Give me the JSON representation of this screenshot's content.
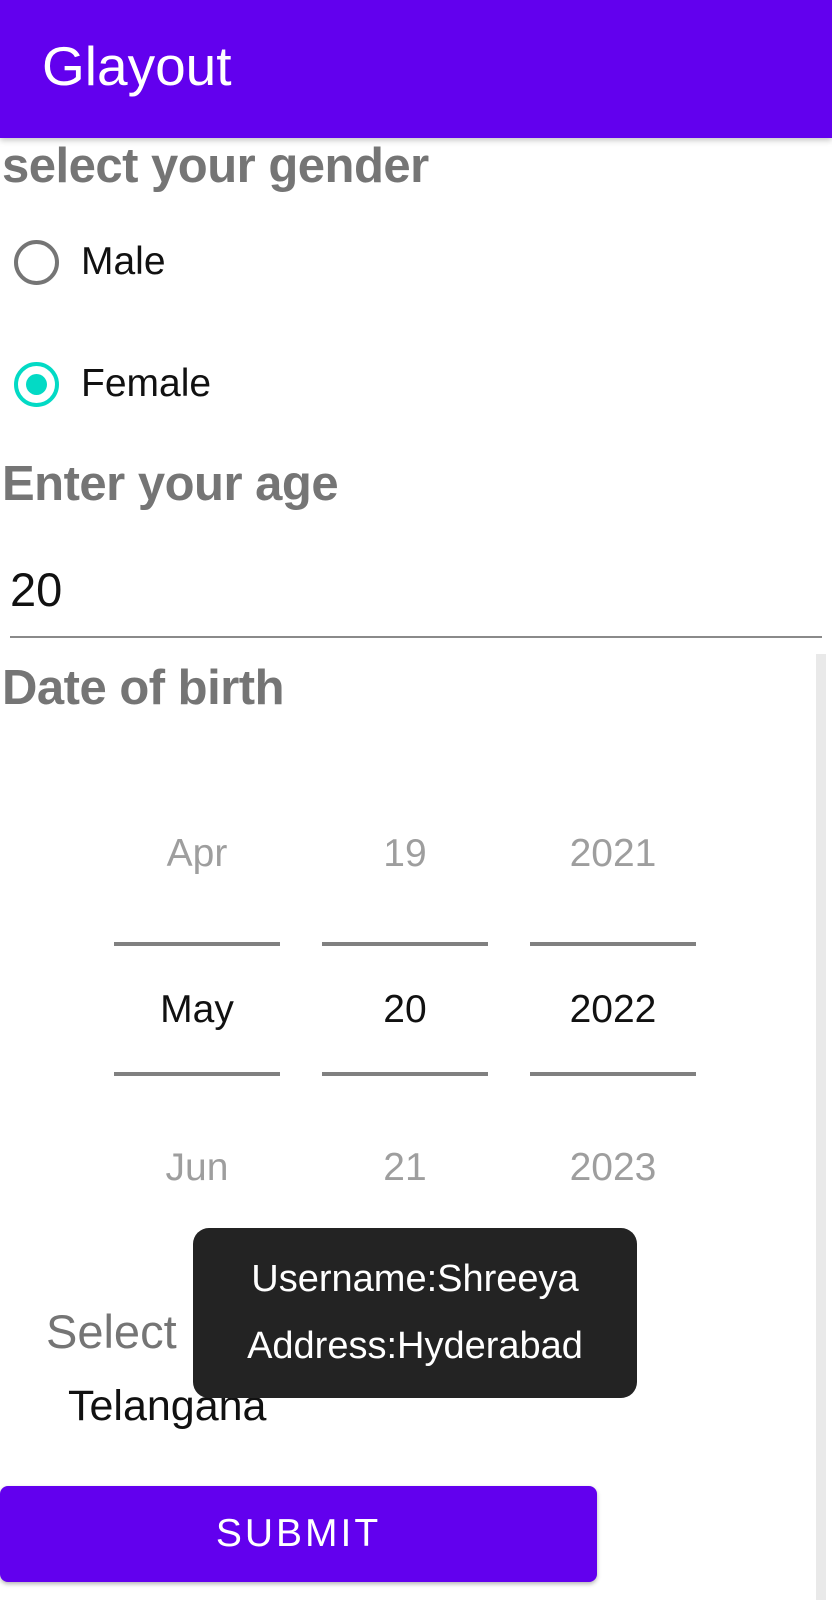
{
  "app_bar": {
    "title": "Glayout",
    "color": "#6200EE"
  },
  "gender": {
    "label": "select your gender",
    "options": [
      {
        "label": "Male",
        "checked": false
      },
      {
        "label": "Female",
        "checked": true
      }
    ],
    "accent_color": "#03DAC5"
  },
  "age": {
    "label": "Enter your age",
    "value": "20"
  },
  "dob": {
    "label": "Date of birth",
    "month": {
      "prev": "Apr",
      "current": "May",
      "next": "Jun"
    },
    "day": {
      "prev": "19",
      "current": "20",
      "next": "21"
    },
    "year": {
      "prev": "2021",
      "current": "2022",
      "next": "2023"
    }
  },
  "state": {
    "label": "Select",
    "value": "Telangana"
  },
  "toast": {
    "line1": "Username:Shreeya",
    "line2": "Address:Hyderabad"
  },
  "submit": {
    "label": "SUBMIT"
  }
}
